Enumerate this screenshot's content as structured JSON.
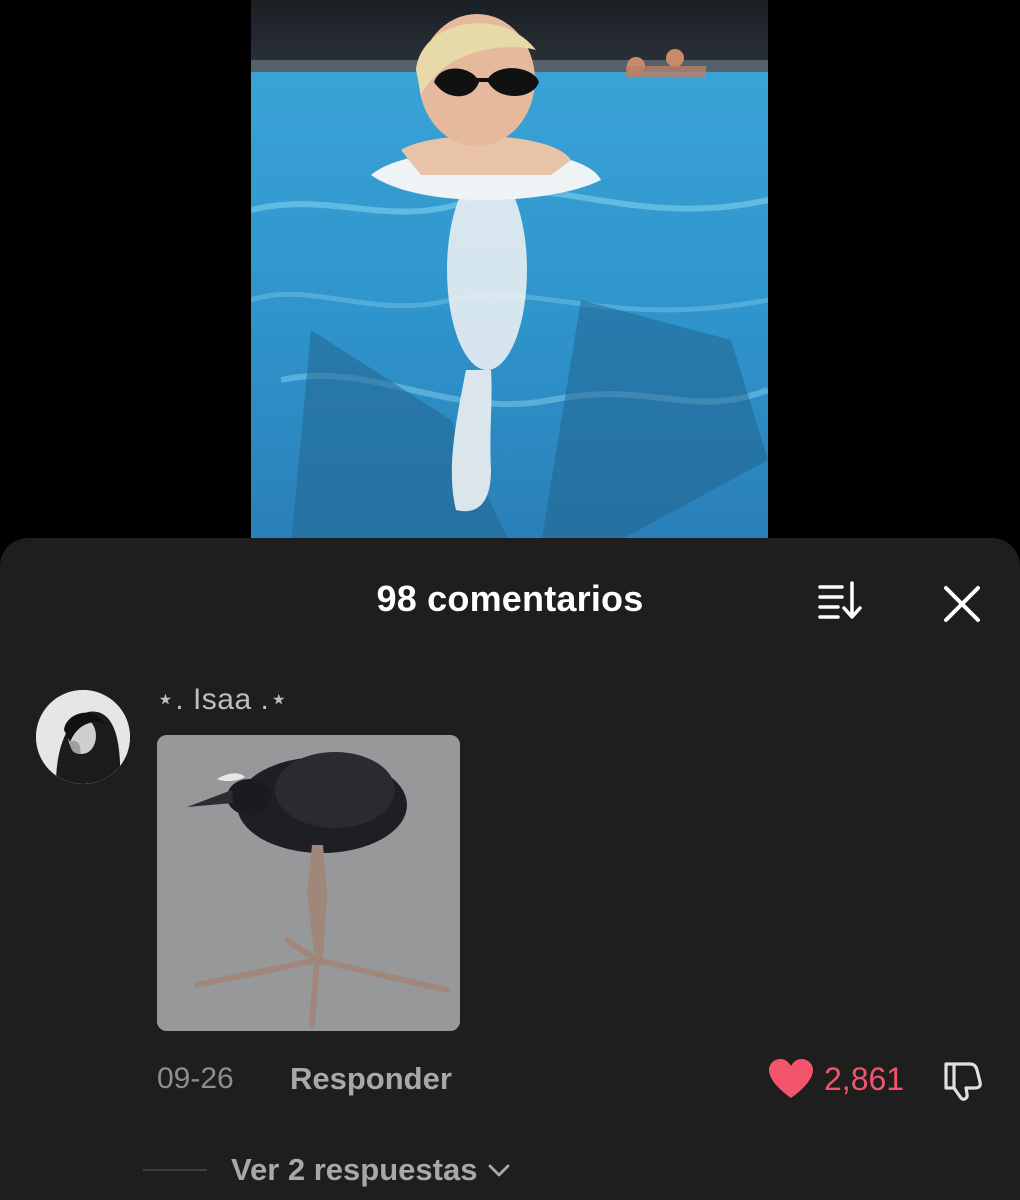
{
  "video": {
    "scene_icon": "pool-video-frame"
  },
  "sheet": {
    "title": "98 comentarios",
    "sort_icon": "sort-icon",
    "close_icon": "close-icon"
  },
  "comment": {
    "username": "⋆. Isaa .⋆",
    "avatar_icon": "avatar",
    "image_icon": "bird-sticker-image",
    "date": "09-26",
    "reply_label": "Responder",
    "likes": "2,861",
    "liked": true,
    "like_color": "#f2546b",
    "replies_label": "Ver 2 respuestas"
  },
  "colors": {
    "background": "#000000",
    "sheet": "#1e1e1e",
    "text_primary": "#ffffff",
    "text_secondary": "#a8a8a8",
    "accent": "#f2546b"
  }
}
